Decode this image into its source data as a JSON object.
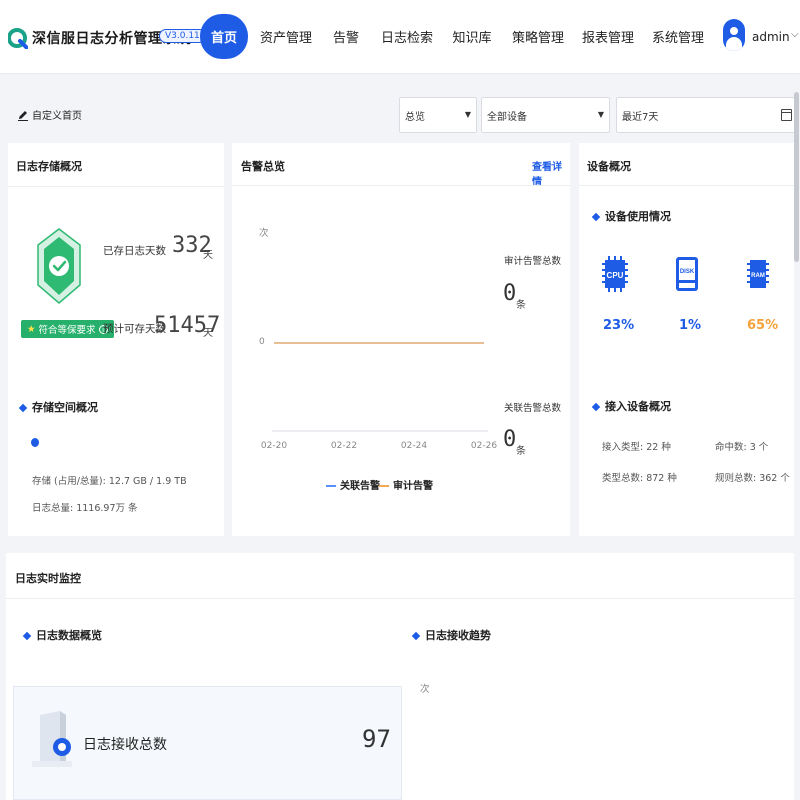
{
  "header": {
    "app_title": "深信服日志分析管理系统",
    "version": "V3.0.11",
    "nav": [
      {
        "label": "首页",
        "active": true
      },
      {
        "label": "资产管理"
      },
      {
        "label": "告警"
      },
      {
        "label": "日志检索"
      },
      {
        "label": "知识库"
      },
      {
        "label": "策略管理"
      },
      {
        "label": "报表管理"
      },
      {
        "label": "系统管理"
      }
    ],
    "username": "admin"
  },
  "toolbar": {
    "custom_home_label": "自定义首页",
    "view_select": "总览",
    "device_select": "全部设备",
    "date_range": "最近7天"
  },
  "storage": {
    "title": "日志存储概况",
    "stored_days_label": "已存日志天数",
    "stored_days_value": "332",
    "days_unit": "天",
    "compliance_badge": "符合等保要求",
    "expected_days_label": "预计可存天数",
    "expected_days_value": "51457",
    "space_title": "存储空间概况",
    "storage_usage": "存储 (占用/总量): 12.7 GB / 1.9 TB",
    "log_total": "日志总量: 1116.97万 条"
  },
  "alarm": {
    "title": "告警总览",
    "view_details": "查看详情",
    "y_unit": "次",
    "y_zero": "0",
    "x_ticks": [
      "02-20",
      "02-22",
      "02-24",
      "02-26"
    ],
    "audit_total_label": "审计告警总数",
    "audit_total_value": "0",
    "correlation_total_label": "关联告警总数",
    "correlation_total_value": "0",
    "count_unit": "条",
    "legend": [
      {
        "name": "关联告警",
        "color": "#5b8ff9"
      },
      {
        "name": "审计告警",
        "color": "#f6a756"
      }
    ]
  },
  "chart_data": {
    "type": "line",
    "x": [
      "02-20",
      "02-22",
      "02-24",
      "02-26"
    ],
    "series": [
      {
        "name": "关联告警",
        "values": [
          0,
          0,
          0,
          0
        ]
      },
      {
        "name": "审计告警",
        "values": [
          0,
          0,
          0,
          0
        ]
      }
    ],
    "ylabel": "次",
    "legend": "bottom"
  },
  "device": {
    "title": "设备概况",
    "usage_title": "设备使用情况",
    "cpu_icon_text": "CPU",
    "disk_icon_text": "DISK",
    "ram_icon_text": "RAM",
    "cpu_percent": "23%",
    "disk_percent": "1%",
    "ram_percent": "65%",
    "cpu_color": "#1e5ce6",
    "disk_color": "#1e5ce6",
    "ram_color": "#f6a23a",
    "access_title": "接入设备概况",
    "access_type": "接入类型: 22 种",
    "hit_count": "命中数: 3 个",
    "type_total": "类型总数: 872 种",
    "rule_total": "规则总数: 362 个"
  },
  "monitor": {
    "title": "日志实时监控",
    "data_overview_title": "日志数据概览",
    "receive_trend_title": "日志接收趋势",
    "receive_total_label": "日志接收总数",
    "receive_total_value": "97",
    "trend_y_unit": "次"
  }
}
